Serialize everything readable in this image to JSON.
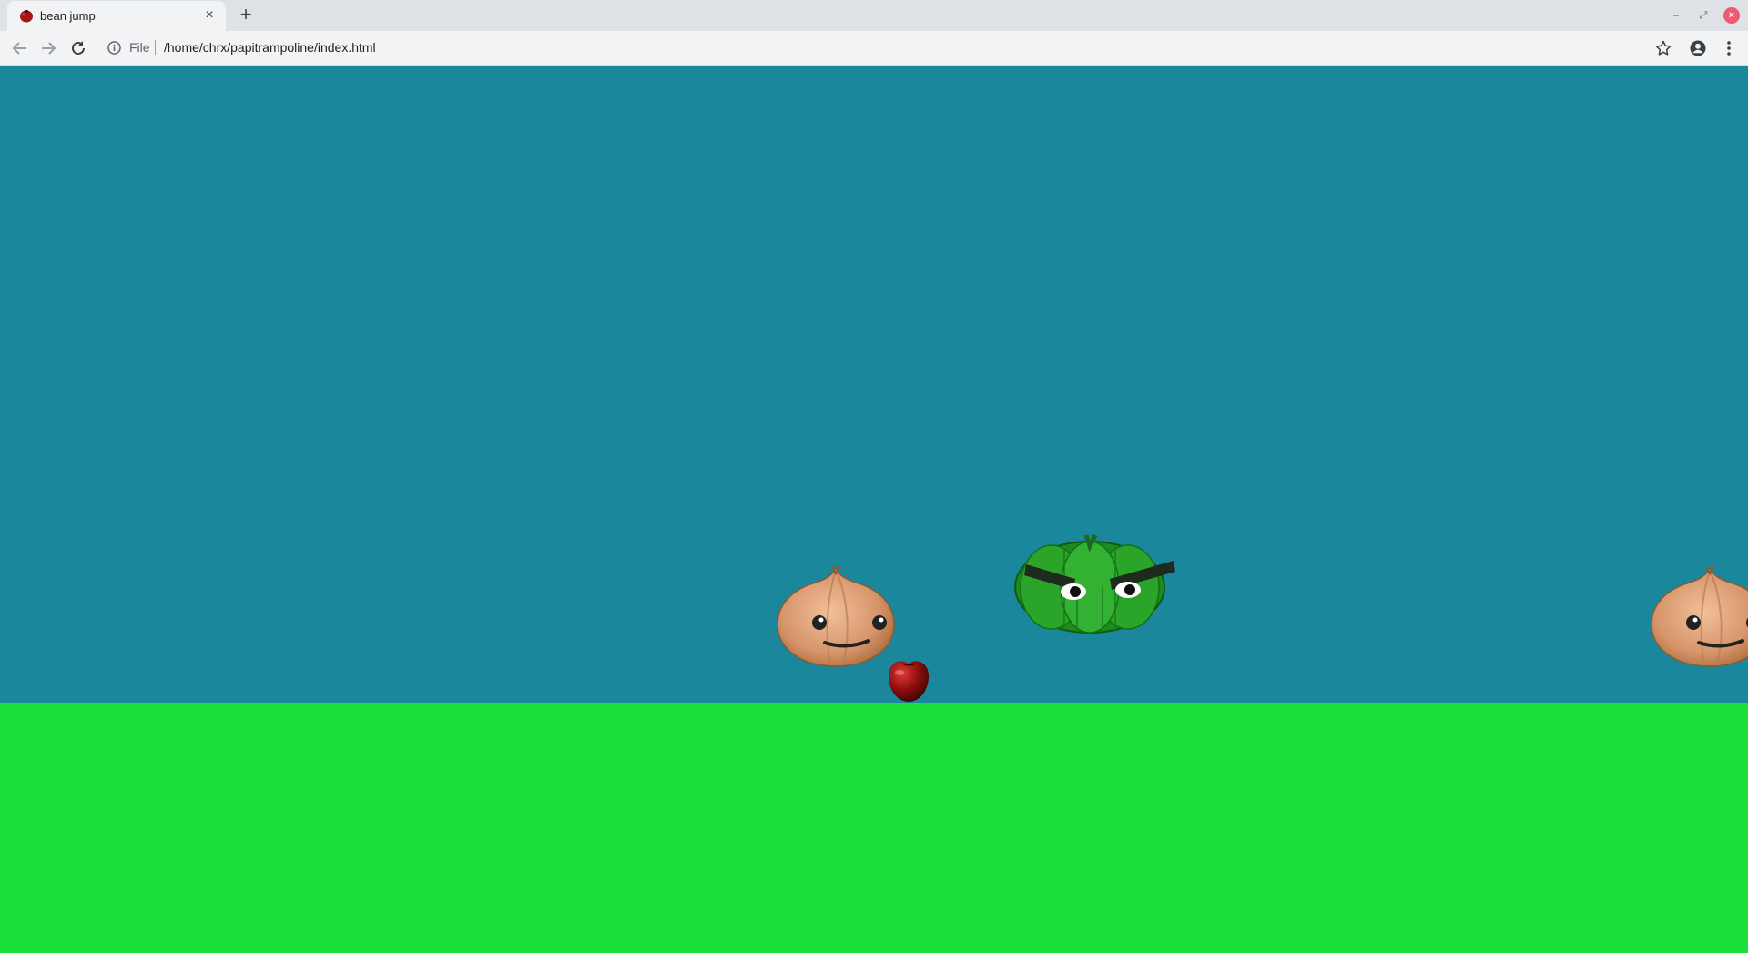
{
  "browser": {
    "tab": {
      "title": "bean jump",
      "close_glyph": "×",
      "favicon": "bean-favicon"
    },
    "new_tab_glyph": "+",
    "window_controls": {
      "minimize": "–",
      "maximize": "⤢",
      "close": "×"
    },
    "address_bar": {
      "scheme": "File",
      "url": "/home/chrx/papitrampoline/index.html"
    }
  },
  "game": {
    "colors": {
      "sky": "#1a879c",
      "ground": "#1be03a"
    },
    "sprites": {
      "friendly_enemy": "onion",
      "angry_enemy": "pumpkin",
      "player": "bean"
    }
  }
}
